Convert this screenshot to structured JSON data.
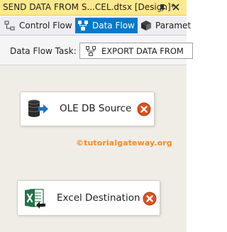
{
  "document_tab": {
    "title": "SEND DATA FROM S...CEL.dtsx [Design]*",
    "pin_icon": "pin-icon",
    "close_icon": "close-icon",
    "accent": "#ffe98f"
  },
  "designer_tabs": [
    {
      "label": "Control Flow",
      "icon": "control-flow-icon",
      "active": false
    },
    {
      "label": "Data Flow",
      "icon": "data-flow-icon",
      "active": true
    },
    {
      "label": "Paramet",
      "icon": "parameters-icon",
      "active": false
    }
  ],
  "active_tab_color": "#007acc",
  "task_bar": {
    "label": "Data Flow Task:",
    "selected_task": "EXPORT DATA FROM",
    "task_icon": "data-flow-task-icon"
  },
  "canvas": {
    "background": "#f0ede7",
    "components": [
      {
        "label": "OLE DB Source",
        "icon": "ole-db-source-icon",
        "status_icon": "error-icon"
      },
      {
        "label": "Excel Destination",
        "icon": "excel-destination-icon",
        "status_icon": "error-icon"
      }
    ],
    "watermark": "©tutorialgateway.org",
    "watermark_color": "#f08c28"
  }
}
